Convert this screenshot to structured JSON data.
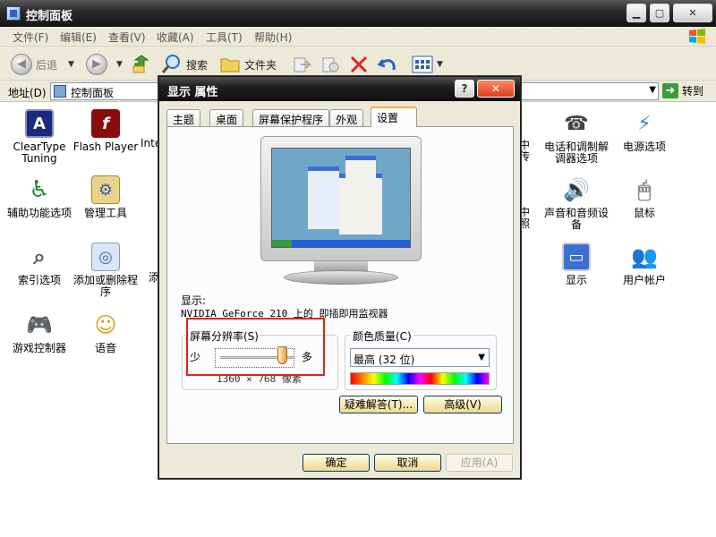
{
  "window": {
    "title": "控制面板"
  },
  "menubar": [
    "文件(F)",
    "编辑(E)",
    "查看(V)",
    "收藏(A)",
    "工具(T)",
    "帮助(H)"
  ],
  "toolbar": {
    "back": "后退",
    "search": "搜索",
    "folders": "文件夹"
  },
  "address": {
    "label": "地址(D)",
    "value": "控制面板",
    "go": "转到"
  },
  "icons": {
    "cleartype": "ClearType Tuning",
    "flash": "Flash Player",
    "inte": "Inte",
    "accessibility": "辅助功能选项",
    "admin_tools": "管理工具",
    "indexing": "索引选项",
    "add_remove": "添加或删除程序",
    "tian": "添",
    "game_controllers": "游戏控制器",
    "speech": "语音",
    "chuan": "中传",
    "phone_modem": "电话和调制解调器选项",
    "power": "电源选项",
    "zhao": "中照",
    "sounds": "声音和音频设备",
    "mouse": "鼠标",
    "display": "显示",
    "user_accounts": "用户帐户"
  },
  "dialog": {
    "title": "显示 属性",
    "tabs": [
      "主题",
      "桌面",
      "屏幕保护程序",
      "外观",
      "设置"
    ],
    "display_label": "显示:",
    "display_value": "NVIDIA GeForce 210 上的 即插即用监视器",
    "resolution": {
      "label": "屏幕分辨率(S)",
      "min": "少",
      "max": "多",
      "value": "1360 × 768 像素",
      "level": 0.85
    },
    "color_quality": {
      "label": "颜色质量(C)",
      "value": "最高 (32 位)"
    },
    "troubleshoot": "疑难解答(T)...",
    "advanced": "高级(V)",
    "ok": "确定",
    "cancel": "取消",
    "apply": "应用(A)"
  }
}
